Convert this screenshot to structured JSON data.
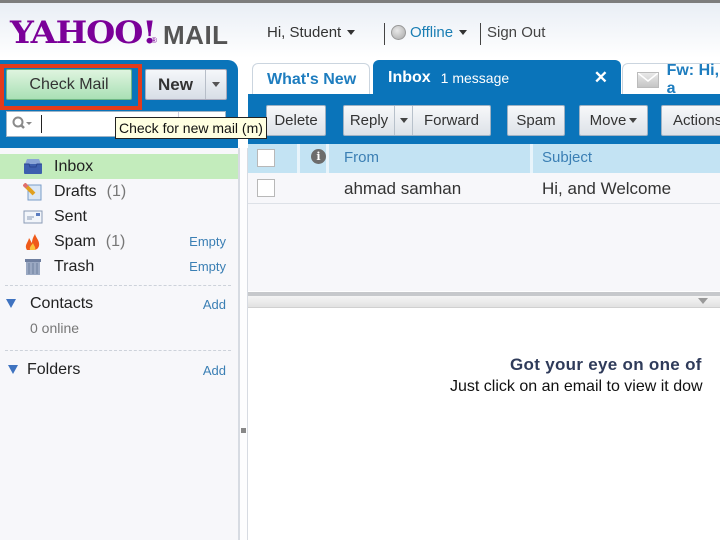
{
  "header": {
    "logo_main": "YAHOO!",
    "logo_reg": "®",
    "logo_product": "MAIL",
    "greeting": "Hi, Student",
    "status": "Offline",
    "sign_out": "Sign Out"
  },
  "left_panel": {
    "check_mail": "Check Mail",
    "new": "New",
    "search_placeholder": "",
    "tooltip": "Check for new mail (m)"
  },
  "folders": [
    {
      "label": "Inbox",
      "count": "",
      "action": "",
      "icon": "inbox-icon",
      "active": true
    },
    {
      "label": "Drafts",
      "count": "(1)",
      "action": "",
      "icon": "drafts-icon",
      "active": false
    },
    {
      "label": "Sent",
      "count": "",
      "action": "",
      "icon": "sent-icon",
      "active": false
    },
    {
      "label": "Spam",
      "count": "(1)",
      "action": "Empty",
      "icon": "spam-icon",
      "active": false
    },
    {
      "label": "Trash",
      "count": "",
      "action": "Empty",
      "icon": "trash-icon",
      "active": false
    }
  ],
  "contacts": {
    "label": "Contacts",
    "action": "Add",
    "sub": "0 online"
  },
  "folders_section": {
    "label": "Folders",
    "action": "Add"
  },
  "tabs": [
    {
      "label": "What's New",
      "sub": ""
    },
    {
      "label": "Inbox",
      "sub": "1 message",
      "close": "✕"
    },
    {
      "label": "Fw: Hi, a",
      "sub": ""
    }
  ],
  "toolbar": {
    "delete": "Delete",
    "reply": "Reply",
    "forward": "Forward",
    "spam": "Spam",
    "move": "Move",
    "actions": "Actions"
  },
  "message_list": {
    "columns": [
      "From",
      "Subject"
    ],
    "rows": [
      {
        "from": "ahmad samhan",
        "subject": "Hi, and Welcome"
      }
    ]
  },
  "preview": {
    "title": "Got your eye on one of",
    "subtitle": "Just click on an email to view it dow"
  },
  "colors": {
    "brand_purple": "#7b0099",
    "frame_blue": "#0a74ba",
    "highlight_red": "#e33b1c",
    "active_green": "#c3ecbc",
    "link_blue": "#3b7fb4"
  }
}
